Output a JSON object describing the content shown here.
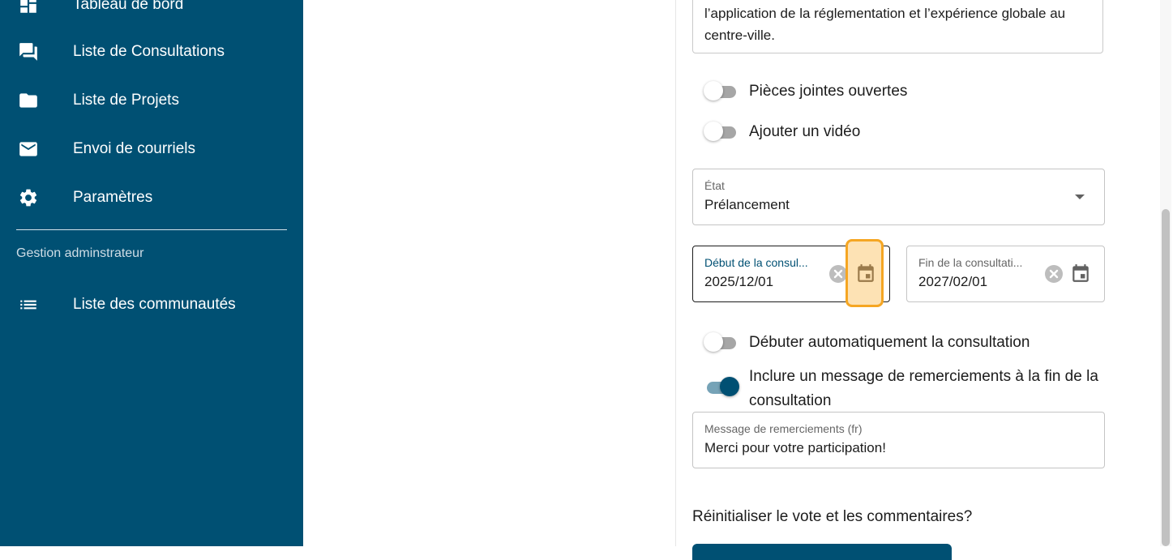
{
  "sidebar": {
    "items": [
      {
        "label": "Tableau de bord",
        "icon": "dashboard-icon"
      },
      {
        "label": "Liste de Consultations",
        "icon": "forum-icon"
      },
      {
        "label": "Liste de Projets",
        "icon": "folder-icon"
      },
      {
        "label": "Envoi de courriels",
        "icon": "mail-icon"
      },
      {
        "label": "Paramètres",
        "icon": "gear-icon"
      }
    ],
    "admin_section_label": "Gestion adminstrateur",
    "admin_items": [
      {
        "label": "Liste des communautés",
        "icon": "list-icon"
      }
    ]
  },
  "form": {
    "description_text": "l’application de la réglementation et l’expérience globale au centre-ville.",
    "toggles": [
      {
        "label": "Pièces jointes ouvertes",
        "checked": false
      },
      {
        "label": "Ajouter un vidéo",
        "checked": false
      },
      {
        "label": "Débuter automatiquement la consultation",
        "checked": false
      },
      {
        "label": "Inclure un message de remerciements à la fin de la consultation",
        "checked": true
      }
    ],
    "state": {
      "label": "État",
      "value": "Prélancement"
    },
    "start_date": {
      "label": "Début de la consul...",
      "value": "2025/12/01"
    },
    "end_date": {
      "label": "Fin de la consultati...",
      "value": "2027/02/01"
    },
    "thanks_message": {
      "label": "Message de remerciements (fr)",
      "value": "Merci pour votre participation!"
    },
    "reset_question": "Réinitialiser le vote et les commentaires?"
  },
  "colors": {
    "sidebar_bg": "#005073",
    "accent": "#005073",
    "highlight": "#f5a623"
  }
}
